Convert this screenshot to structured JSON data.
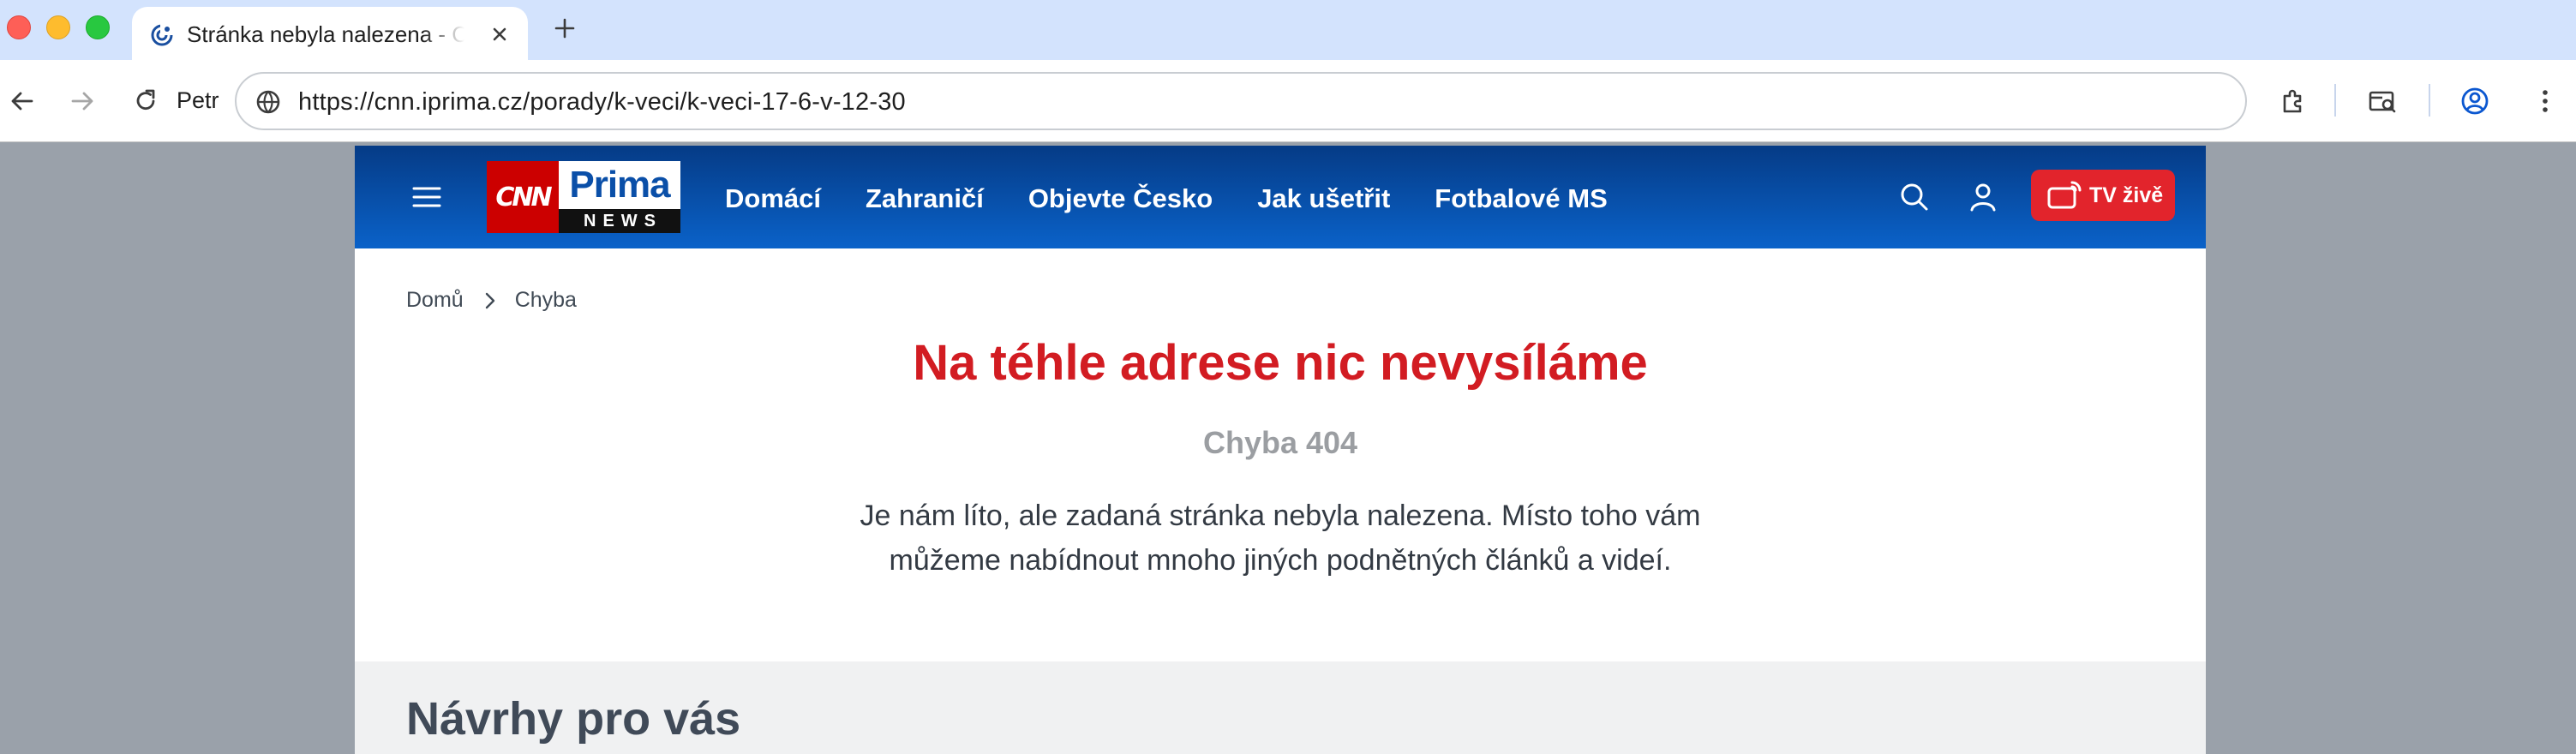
{
  "browser": {
    "tab": {
      "title": "Stránka nebyla nalezena - CNN Prima NEWS",
      "close_icon": "close-icon"
    },
    "new_tab_label": "+",
    "profile_name": "Petr",
    "address": "https://cnn.iprima.cz/porady/k-veci/k-veci-17-6-v-12-30",
    "icons": [
      "back-arrow-icon",
      "forward-arrow-icon",
      "reload-icon",
      "site-info-icon",
      "extensions-icon",
      "tab-search-icon",
      "profile-icon",
      "more-menu-icon"
    ]
  },
  "site": {
    "logo": {
      "cnn": "CNN",
      "prima": "Prima",
      "news": "NEWS"
    },
    "nav": [
      "Domácí",
      "Zahraničí",
      "Objevte Česko",
      "Jak ušetřit",
      "Fotbalové MS"
    ],
    "live_button": "TV živě",
    "brand_colors": {
      "header_top": "#053b86",
      "header_bottom": "#0a62c9",
      "accent_red": "#d21c22"
    },
    "breadcrumb": [
      "Domů",
      "Chyba"
    ],
    "error": {
      "title": "Na téhle adrese nic nevysíláme",
      "code": "Chyba 404",
      "message": "Je nám líto, ale zadaná stránka nebyla nalezena. Místo toho vám můžeme nabídnout mnoho jiných podnětných článků a videí."
    },
    "suggestions_title": "Návrhy pro vás"
  }
}
